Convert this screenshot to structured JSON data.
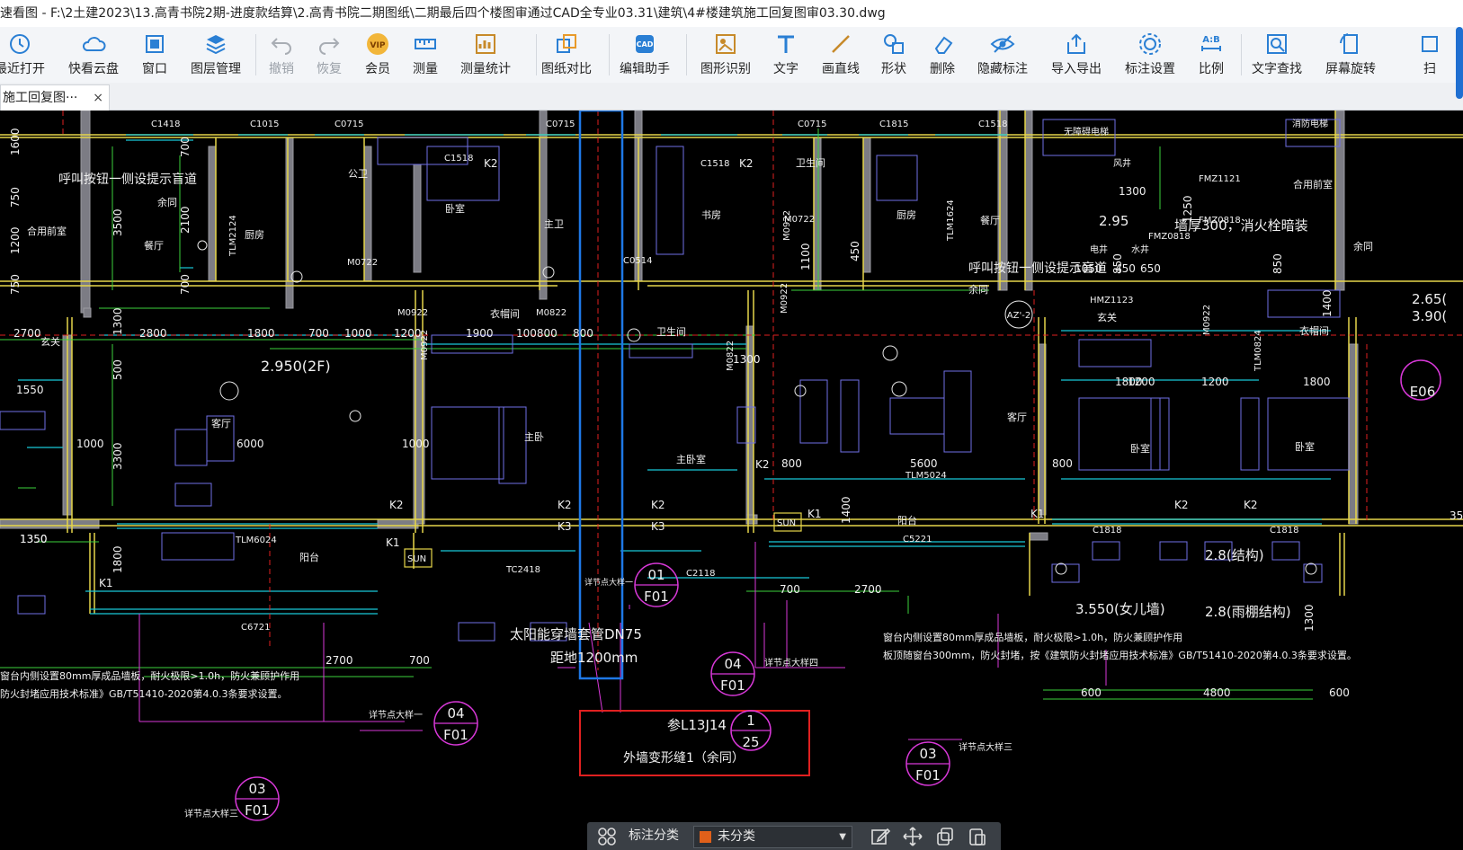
{
  "window": {
    "title": "速看图 - F:\\2土建2023\\13.高青书院2期-进度款结算\\2.高青书院二期图纸\\二期最后四个楼图审通过CAD全专业03.31\\建筑\\4#楼建筑施工回复图审03.30.dwg"
  },
  "toolbar": {
    "items": [
      {
        "label": "最近打开",
        "icon": "clock-icon"
      },
      {
        "label": "快看云盘",
        "icon": "cloud-icon"
      },
      {
        "label": "窗口",
        "icon": "window-icon"
      },
      {
        "label": "图层管理",
        "icon": "layers-icon"
      },
      {
        "label": "撤销",
        "icon": "undo-icon"
      },
      {
        "label": "恢复",
        "icon": "redo-icon"
      },
      {
        "label": "会员",
        "icon": "vip-icon"
      },
      {
        "label": "测量",
        "icon": "ruler-icon"
      },
      {
        "label": "测量统计",
        "icon": "measure-stats-icon"
      },
      {
        "label": "图纸对比",
        "icon": "compare-icon"
      },
      {
        "label": "编辑助手",
        "icon": "cad-edit-icon"
      },
      {
        "label": "图形识别",
        "icon": "shape-recognize-icon"
      },
      {
        "label": "文字",
        "icon": "text-icon"
      },
      {
        "label": "画直线",
        "icon": "line-icon"
      },
      {
        "label": "形状",
        "icon": "shapes-icon"
      },
      {
        "label": "删除",
        "icon": "eraser-icon"
      },
      {
        "label": "隐藏标注",
        "icon": "eye-hide-icon"
      },
      {
        "label": "导入导出",
        "icon": "import-export-icon"
      },
      {
        "label": "标注设置",
        "icon": "annotation-settings-icon"
      },
      {
        "label": "比例",
        "icon": "scale-icon"
      },
      {
        "label": "文字查找",
        "icon": "text-search-icon"
      },
      {
        "label": "屏幕旋转",
        "icon": "rotate-screen-icon"
      },
      {
        "label": "扫",
        "icon": "scan-icon"
      }
    ]
  },
  "tab": {
    "label": "施工回复图···",
    "close": "×"
  },
  "drawing": {
    "texts": {
      "elev_2f": "2.950(2F)",
      "elev_295": "2.95",
      "elev_28a": "2.8(结构)",
      "elev_28b": "2.8(雨棚结构)",
      "elev_3550": "3.550(女儿墙)",
      "elev_265": "2.65(",
      "elev_390": "3.90(",
      "wall_note": "墙厚300，消火栓暗装",
      "call_btn1": "呼叫按钮一侧设提示盲道",
      "call_btn2": "呼叫按钮一侧设提示盲道",
      "solar1": "太阳能穿墙套管DN75",
      "solar2": "距地1200mm",
      "note_right1": "窗台内侧设置80mm厚成品墙板，耐火极限>1.0h，防火兼顾护作用",
      "note_right2": "板顶随窗台300mm，防火封堵，按《建筑防火封堵应用技术标准》GB/T51410-2020第4.0.3条要求设置。",
      "note_left1": "窗台内侧设置80mm厚成品墙板，耐火极限>1.0h，防火兼顾护作用",
      "note_left2": "防火封堵应用技术标准》GB/T51410-2020第4.0.3条要求设置。",
      "ref_title": "参L13J14",
      "ref_desc": "外墙变形缝1（余同）",
      "ref_num": "1",
      "ref_den": "25",
      "detail_note": "详节点大样一",
      "detail_note2": "详节点大样四",
      "detail_note3": "详节点大样三",
      "c01_num": "01",
      "c01_den": "F01",
      "c04a_num": "04",
      "c04a_den": "F01",
      "c04b_num": "04",
      "c04b_den": "F01",
      "c03a_num": "03",
      "c03a_den": "F01",
      "c03b_num": "03",
      "c03b_den": "F01",
      "e06": "E06",
      "az2": "AZ'-2",
      "room_living1": "客厅",
      "room_living2": "客厅",
      "room_master1": "主卧",
      "room_master2": "主卧室",
      "room_bed1": "卧室",
      "room_bed2": "卧室",
      "room_bed3": "卧室",
      "room_kitchen1": "厨房",
      "room_kitchen2": "厨房",
      "room_dining": "餐厅",
      "room_dining2": "餐厅",
      "room_study": "书房",
      "room_bath1": "公卫",
      "room_bath2": "主卫",
      "room_bath3": "卫生间",
      "room_bath4": "卫生间",
      "room_balcony1": "阳台",
      "room_balcony2": "阳台",
      "room_closet1": "衣帽间",
      "room_closet2": "衣帽间",
      "room_hall1": "玄关",
      "room_hall2": "玄关",
      "room_corridor": "合用前室",
      "room_corridor2": "合用前室",
      "room_yutong": "余同",
      "room_yutong2": "余同",
      "room_yutong3": "余同",
      "d_2700": "2700",
      "d_2800": "2800",
      "d_1800": "1800",
      "d_700": "700",
      "d_1000": "1000",
      "d_1200": "1200",
      "d_1900": "1900",
      "d_100800": "100800",
      "d_800": "800",
      "d_6000": "6000",
      "d_1350": "1350",
      "d_1550": "1550",
      "d_3300": "3300",
      "d_3500": "3500",
      "d_2100": "2100",
      "d_1300": "1300",
      "d_5600": "5600",
      "d_4800": "4800",
      "d_600": "600",
      "d_1400": "1400",
      "d_1250": "1250",
      "d_1050": "1050",
      "d_650": "650",
      "d_850": "850",
      "d_450": "450",
      "d_1100": "1100",
      "d_500": "500",
      "d_1600": "1600",
      "d_750": "750",
      "w_c1418": "C1418",
      "w_c1015": "C1015",
      "w_c0715": "C0715",
      "w_c1518": "C1518",
      "w_c0715b": "C0715",
      "w_c1815": "C1815",
      "w_c1518b": "C1518",
      "w_c1518c": "C1518",
      "w_tlm6024": "TLM6024",
      "w_tlm5024": "TLM5024",
      "w_tc2418": "TC2418",
      "w_c2118": "C2118",
      "w_c6721": "C6721",
      "w_c5221": "C5221",
      "w_c1818a": "C1818",
      "w_c1818b": "C1818",
      "w_m0722": "M0722",
      "w_m0922": "M0922",
      "w_m0822": "M0822",
      "w_c0514": "C0514",
      "w_fmz1121": "FMZ1121",
      "w_fmz0818": "FMZ0818",
      "w_hmz1123": "HMZ1123",
      "w_tlm1624": "TLM1624",
      "w_tlm2124": "TLM2124",
      "w_tlm0824": "TLM0824",
      "k1": "K1",
      "k2": "K2",
      "k3": "K3",
      "sun": "SUN",
      "elec": "电井",
      "water": "水井",
      "fire_elev": "消防电梯",
      "elev_room": "无障碍电梯",
      "wind": "风井"
    }
  },
  "bottombar": {
    "label": "标注分类",
    "selected": "未分类",
    "swatch_color": "#e0601a"
  },
  "colors": {
    "wall_yellow": "#e6d64a",
    "wall_gray": "#9a9aa0",
    "text_white": "#f0f0f0",
    "cyan": "#18c8d8",
    "magenta": "#d838d8",
    "green": "#3cd23c",
    "red": "#e02020",
    "blue_hl": "#1e78e6",
    "purple": "#7070e6"
  }
}
